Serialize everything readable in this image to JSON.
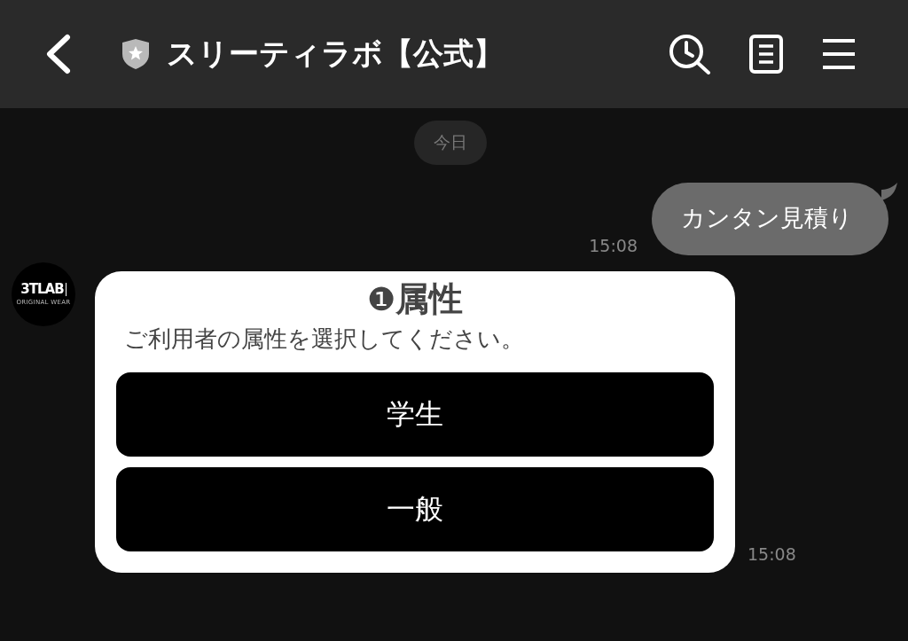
{
  "header": {
    "title": "スリーティラボ【公式】"
  },
  "date_chip": "今日",
  "messages": [
    {
      "kind": "outgoing",
      "text": "カンタン見積り",
      "time": "15:08"
    },
    {
      "kind": "card",
      "avatar": {
        "logo": "3TLAB",
        "tagline": "ORIGINAL WEAR"
      },
      "title_number": "❶",
      "title": "属性",
      "description": "ご利用者の属性を選択してください。",
      "options": [
        "学生",
        "一般"
      ],
      "time": "15:08"
    }
  ]
}
